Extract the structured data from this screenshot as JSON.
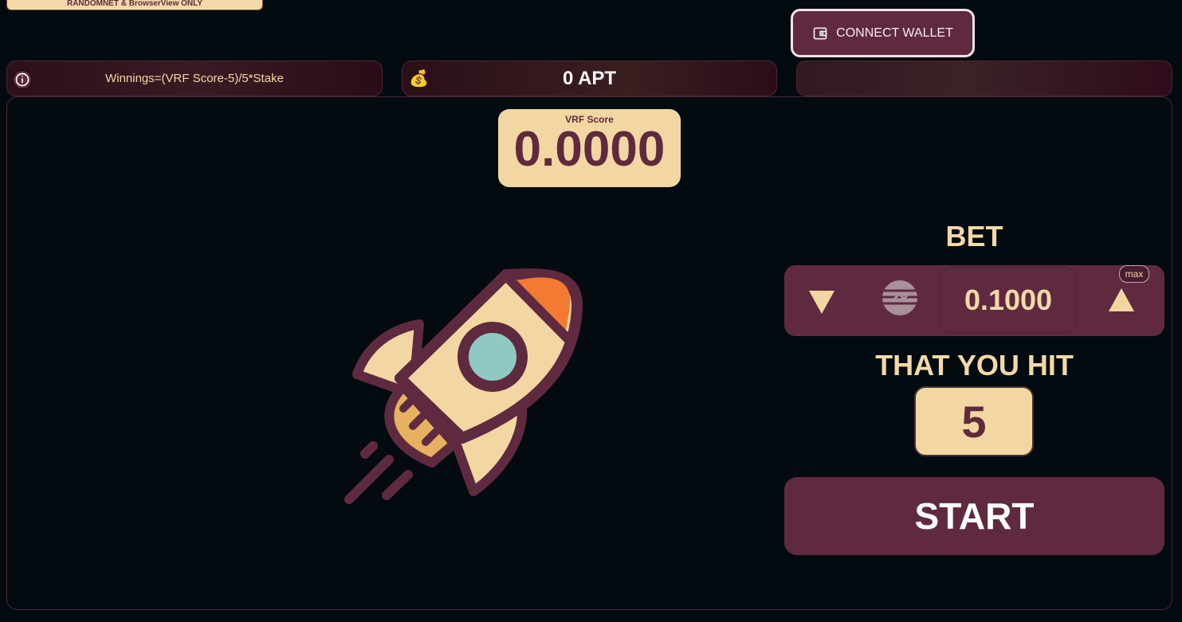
{
  "banner": {
    "text": "RANDOMNET & BrowserView ONLY"
  },
  "header": {
    "connect_label": "CONNECT WALLET"
  },
  "info_bar": {
    "formula": "Winnings=(VRF Score-5)/5*Stake"
  },
  "balance_bar": {
    "icon": "money-bag",
    "balance": "0 APT"
  },
  "vrf": {
    "label": "VRF Score",
    "value": "0.0000"
  },
  "bet": {
    "title": "BET",
    "value": "0.1000",
    "max_label": "max",
    "decrease_icon": "triangle-down",
    "increase_icon": "triangle-up",
    "token_icon": "aptos"
  },
  "hit": {
    "title": "THAT YOU HIT",
    "value": "5"
  },
  "start": {
    "label": "START"
  },
  "colors": {
    "background": "#030b10",
    "accent": "#5f2a40",
    "cream": "#f3d7a3",
    "rocket_window": "#8fcac2",
    "rocket_tip": "#f47a33"
  }
}
